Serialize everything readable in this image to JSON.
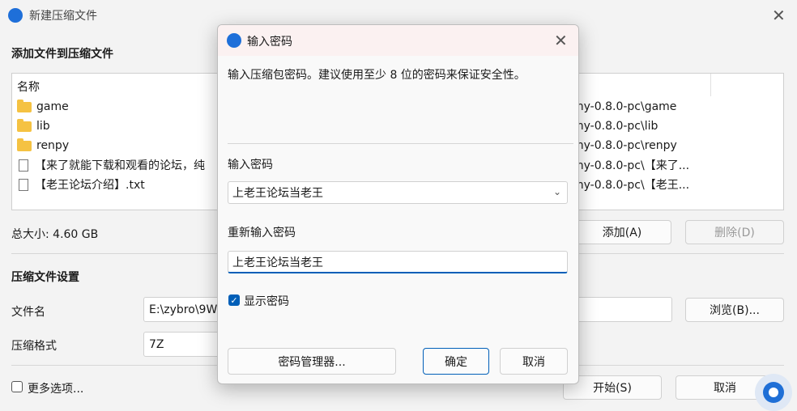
{
  "window": {
    "title": "新建压缩文件",
    "add_section_title": "添加文件到压缩文件",
    "column_name": "名称",
    "files": [
      {
        "name": "game",
        "path": "my-0.8.0-pc\\game",
        "type": "folder"
      },
      {
        "name": "lib",
        "path": "my-0.8.0-pc\\lib",
        "type": "folder"
      },
      {
        "name": "renpy",
        "path": "my-0.8.0-pc\\renpy",
        "type": "folder"
      },
      {
        "name": "【来了就能下载和观看的论坛，纯",
        "path": "my-0.8.0-pc\\【来了...",
        "type": "file"
      },
      {
        "name": "【老王论坛介绍】.txt",
        "path": "my-0.8.0-pc\\【老王...",
        "type": "file"
      }
    ],
    "total_size": "总大小: 4.60 GB",
    "add_button": "添加(A)",
    "delete_button": "删除(D)",
    "settings_title": "压缩文件设置",
    "filename_label": "文件名",
    "filename_value": "E:\\zybro\\9W",
    "browse_button": "浏览(B)...",
    "format_label": "压缩格式",
    "format_value": "7Z",
    "more_options": "更多选项...",
    "start_button": "开始(S)",
    "cancel_button": "取消"
  },
  "dialog": {
    "title": "输入密码",
    "description": "输入压缩包密码。建议使用至少 8 位的密码来保证安全性。",
    "password_label": "输入密码",
    "password_value": "上老王论坛当老王",
    "reenter_label": "重新输入密码",
    "reenter_value": "上老王论坛当老王",
    "show_password_label": "显示密码",
    "show_password_checked": true,
    "password_manager_button": "密码管理器...",
    "ok_button": "确定",
    "cancel_button": "取消"
  },
  "colors": {
    "accent": "#005fb8",
    "app_icon": "#1e6fd9"
  }
}
